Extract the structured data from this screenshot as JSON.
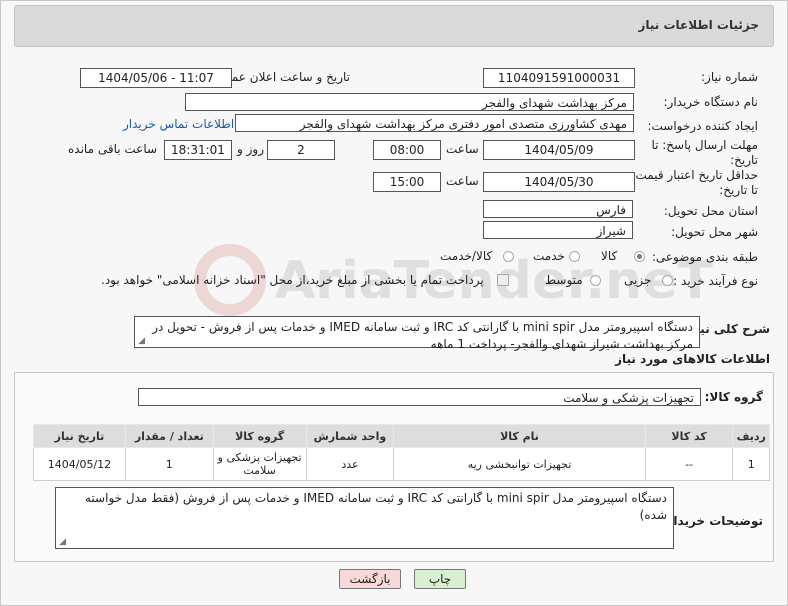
{
  "header": {
    "title": "جزئیات اطلاعات نیاز"
  },
  "fields": {
    "need_number": {
      "label": "شماره نیاز:",
      "value": "1104091591000031"
    },
    "announce": {
      "label": "تاریخ و ساعت اعلان عمومی:",
      "value": "1404/05/06 - 11:07"
    },
    "buyer_org": {
      "label": "نام دستگاه خریدار:",
      "value": "مرکز بهداشت شهدای والفجر"
    },
    "requester": {
      "label": "ایجاد کننده درخواست:",
      "value": "مهدی کشاورزی متصدی امور دفتری مرکز بهداشت شهدای والفجر",
      "contact_link": "اطلاعات تماس خریدار"
    },
    "reply_deadline": {
      "label_line1": "مهلت ارسال پاسخ: تا",
      "label_line2": "تاریخ:",
      "date": "1404/05/09",
      "time_label": "ساعت",
      "time": "08:00",
      "days": "2",
      "days_label": "روز و",
      "remaining": "18:31:01",
      "remaining_label": "ساعت باقی مانده"
    },
    "price_deadline": {
      "label_line1": "حداقل تاریخ اعتبار قیمت:",
      "label_line2": "تا تاریخ:",
      "date": "1404/05/30",
      "time_label": "ساعت",
      "time": "15:00"
    },
    "province": {
      "label": "استان محل تحویل:",
      "value": "فارس"
    },
    "city": {
      "label": "شهر محل تحویل:",
      "value": "شیراز"
    },
    "category": {
      "label": "طبقه بندی موضوعی:",
      "options": [
        "کالا",
        "خدمت",
        "کالا/خدمت"
      ],
      "selected": "کالا"
    },
    "process": {
      "label": "نوع فرآیند خرید :",
      "options": [
        "جزیی",
        "متوسط"
      ],
      "payment_note": "پرداخت تمام یا بخشی از مبلغ خرید،از محل \"اسناد خزانه اسلامی\" خواهد بود."
    }
  },
  "description": {
    "label": "شرح کلی نیاز:",
    "text": "دستگاه اسپیرومتر مدل mini spir با گارانتی کد IRC  و ثبت سامانه IMED و خدمات پس از فروش - تحویل در مرکز بهداشت شیراز شهدای والفجر- پرداخت 1 ماهه"
  },
  "goods_section": {
    "title": "اطلاعات کالاهای مورد نیاز",
    "group_label": "گروه کالا:",
    "group_value": "تجهیزات پزشکی و سلامت",
    "columns": [
      "ردیف",
      "کد کالا",
      "نام کالا",
      "واحد شمارش",
      "گروه کالا",
      "تعداد / مقدار",
      "تاریخ نیاز"
    ],
    "rows": [
      [
        "1",
        "--",
        "تجهیزات توانبخشی ریه",
        "عدد",
        "تجهیزات پزشکی و سلامت",
        "1",
        "1404/05/12"
      ]
    ]
  },
  "buyer_notes": {
    "label": "توضیحات خریدار:",
    "text": "دستگاه اسپیرومتر مدل mini spir با گارانتی کد IRC  و ثبت سامانه IMED و خدمات پس از فروش (فقط مدل خواسته شده)"
  },
  "buttons": {
    "print": "چاپ",
    "back": "بازگشت"
  },
  "watermark": {
    "text": "AriaTender.neT"
  },
  "colors": {
    "link": "#1a5aa8",
    "print_button": "#d8f0d0",
    "back_button": "#f8d8d8",
    "watermark_red": "#c0392b"
  }
}
